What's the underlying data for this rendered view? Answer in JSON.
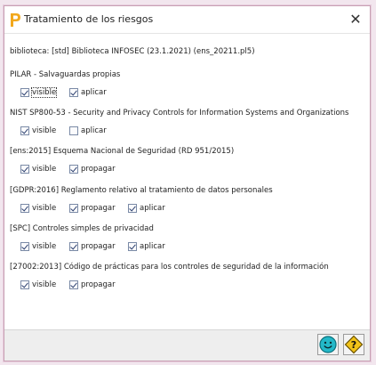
{
  "window": {
    "title": "Tratamiento de los riesgos",
    "close_glyph": "✕"
  },
  "library_line": "biblioteca: [std] Biblioteca INFOSEC (23.1.2021) (ens_20211.pl5)",
  "sections": [
    {
      "title": "PILAR - Salvaguardas propias",
      "options": [
        {
          "label": "visible",
          "checked": true
        },
        {
          "label": "aplicar",
          "checked": true
        }
      ]
    },
    {
      "title": "NIST SP800-53 - Security and Privacy Controls for Information Systems and Organizations",
      "options": [
        {
          "label": "visible",
          "checked": true
        },
        {
          "label": "aplicar",
          "checked": false
        }
      ]
    },
    {
      "title": "[ens:2015] Esquema Nacional de Seguridad (RD 951/2015)",
      "options": [
        {
          "label": "visible",
          "checked": true
        },
        {
          "label": "propagar",
          "checked": true
        }
      ]
    },
    {
      "title": "[GDPR:2016] Reglamento relativo al tratamiento de datos personales",
      "options": [
        {
          "label": "visible",
          "checked": true
        },
        {
          "label": "propagar",
          "checked": true
        },
        {
          "label": "aplicar",
          "checked": true
        }
      ]
    },
    {
      "title": "[SPC] Controles simples de privacidad",
      "options": [
        {
          "label": "visible",
          "checked": true
        },
        {
          "label": "propagar",
          "checked": true
        },
        {
          "label": "aplicar",
          "checked": true
        }
      ]
    },
    {
      "title": "[27002:2013] Código de prácticas para los controles de seguridad de la información",
      "options": [
        {
          "label": "visible",
          "checked": true
        },
        {
          "label": "propagar",
          "checked": true
        }
      ]
    }
  ],
  "footer": {
    "buttons": [
      {
        "icon": "smiley-ok-icon",
        "color": "#23b8c8"
      },
      {
        "icon": "help-icon",
        "color": "#f2c318"
      }
    ]
  },
  "colors": {
    "app_icon": "#f2a81d",
    "frame": "#c8a0b4"
  }
}
